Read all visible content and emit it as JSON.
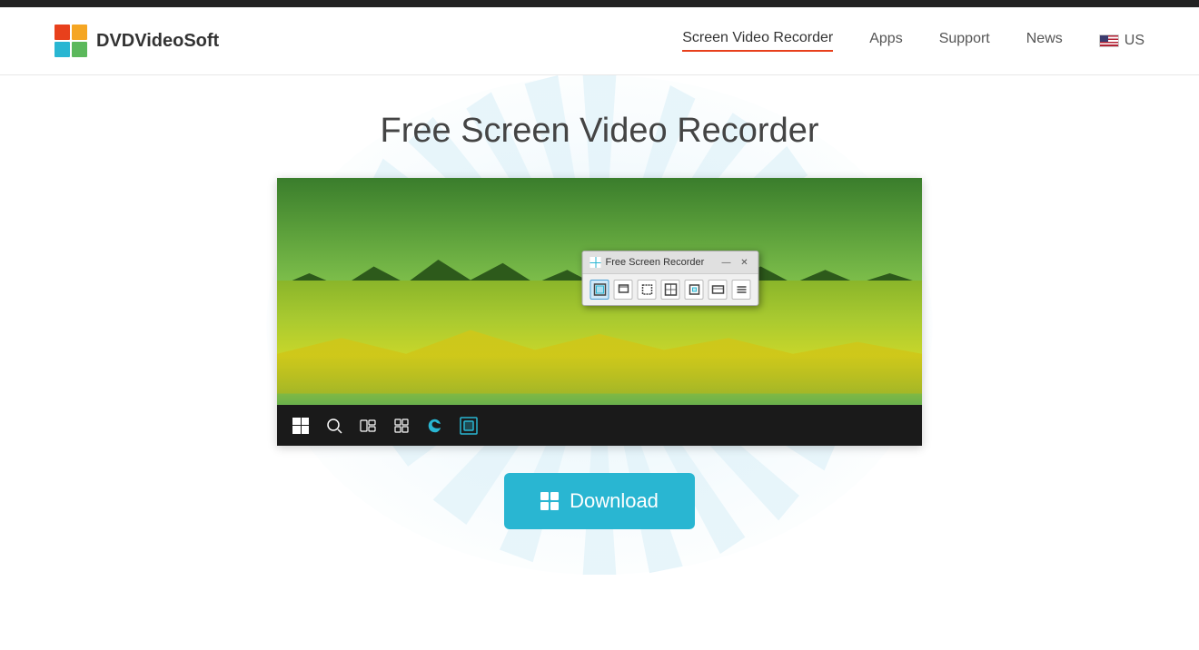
{
  "topBar": {},
  "header": {
    "logo": {
      "text": "DVDVideoSoft"
    },
    "nav": {
      "items": [
        {
          "label": "Screen Video Recorder",
          "active": true
        },
        {
          "label": "Apps",
          "active": false
        },
        {
          "label": "Support",
          "active": false
        },
        {
          "label": "News",
          "active": false
        },
        {
          "label": "US",
          "active": false
        }
      ]
    }
  },
  "main": {
    "title": "Free Screen Video Recorder",
    "appWindow": {
      "title": "Free Screen Recorder",
      "controls": {
        "minimize": "—",
        "close": "✕"
      }
    },
    "downloadButton": {
      "label": "Download"
    }
  }
}
